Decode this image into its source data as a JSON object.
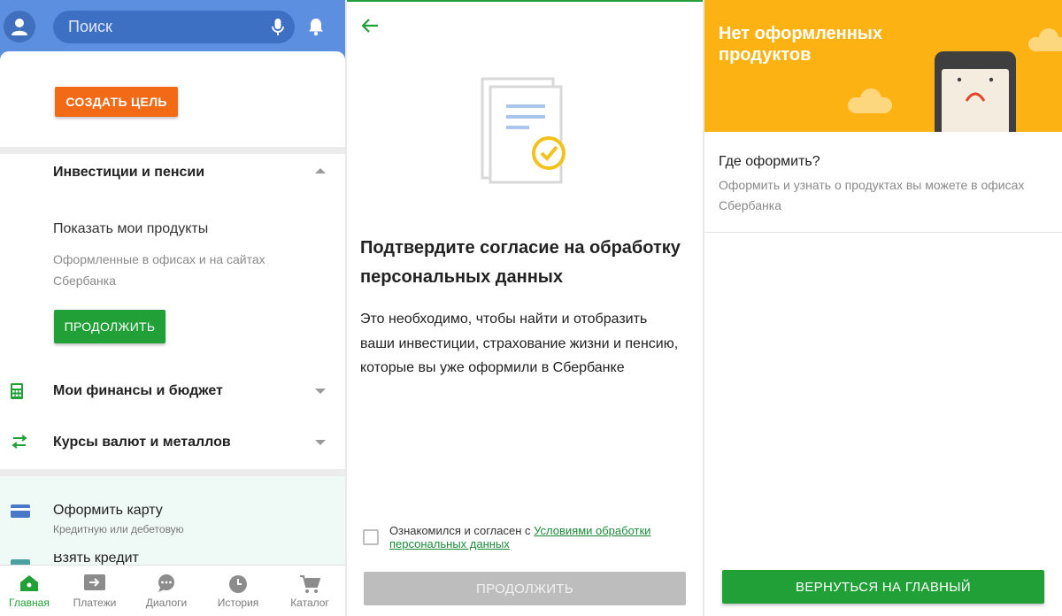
{
  "colors": {
    "brand_green": "#21a038",
    "header_blue": "#5d8fe0",
    "orange": "#f36a16",
    "banner_yellow": "#fdb214"
  },
  "home": {
    "search_placeholder": "Поиск",
    "create_goal_button": "СОЗДАТЬ ЦЕЛЬ",
    "investments": {
      "title": "Инвестиции и пенсии",
      "show_products": "Показать мои продукты",
      "subtitle": "Оформленные в офисах и на сайтах Сбербанка",
      "continue_button": "ПРОДОЛЖИТЬ"
    },
    "finances_title": "Мои финансы и бюджет",
    "rates_title": "Курсы валют и металлов",
    "promo": {
      "title": "Оформить карту",
      "subtitle": "Кредитную или дебетовую",
      "next_cut": "Взять кредит"
    },
    "tabs": [
      {
        "label": "Главная",
        "icon": "home-icon"
      },
      {
        "label": "Платежи",
        "icon": "payments-icon"
      },
      {
        "label": "Диалоги",
        "icon": "chat-icon"
      },
      {
        "label": "История",
        "icon": "clock-icon"
      },
      {
        "label": "Каталог",
        "icon": "cart-icon"
      }
    ]
  },
  "consent": {
    "title": "Подтвердите согласие на обработку персональных данных",
    "body": "Это необходимо, чтобы найти и отобразить ваши инвестиции, страхование жизни и пенсию, которые вы уже оформили в Сбербанке",
    "checkbox_prefix": "Ознакомился и согласен с ",
    "checkbox_link": "Условиями обработки персональных данных",
    "continue_button": "ПРОДОЛЖИТЬ"
  },
  "empty": {
    "banner_title": "Нет оформленных продуктов",
    "question": "Где оформить?",
    "answer": "Оформить и узнать о продуктах вы можете в офисах Сбербанка",
    "home_button": "ВЕРНУТЬСЯ НА ГЛАВНЫЙ"
  }
}
